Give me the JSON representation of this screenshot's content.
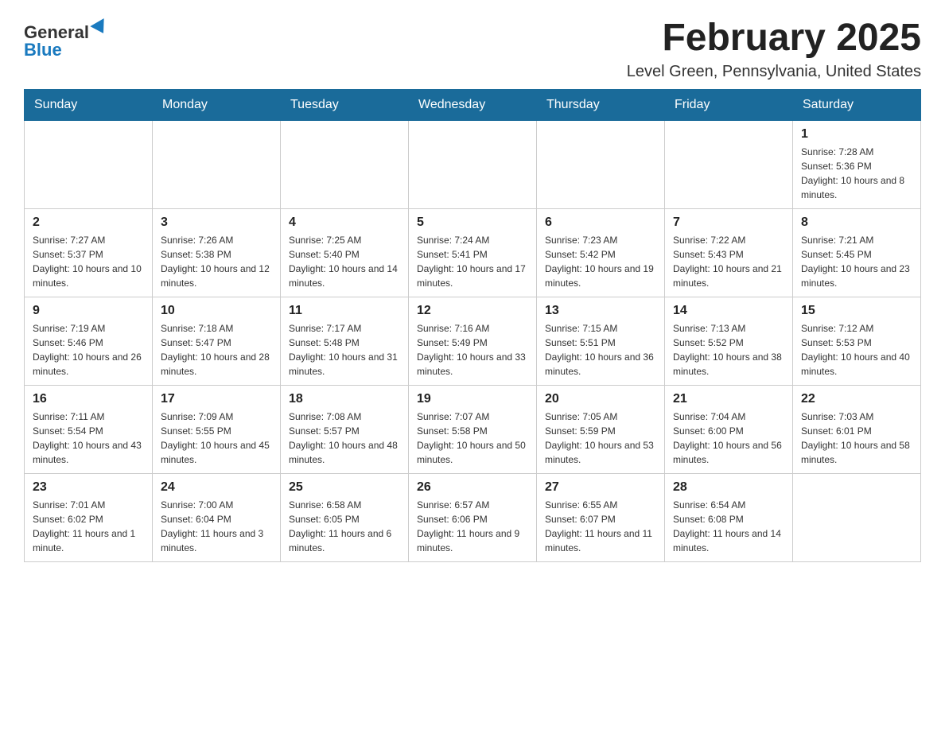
{
  "header": {
    "logo_general": "General",
    "logo_blue": "Blue",
    "month_title": "February 2025",
    "location": "Level Green, Pennsylvania, United States"
  },
  "days_of_week": [
    "Sunday",
    "Monday",
    "Tuesday",
    "Wednesday",
    "Thursday",
    "Friday",
    "Saturday"
  ],
  "weeks": [
    [
      {
        "day": "",
        "info": ""
      },
      {
        "day": "",
        "info": ""
      },
      {
        "day": "",
        "info": ""
      },
      {
        "day": "",
        "info": ""
      },
      {
        "day": "",
        "info": ""
      },
      {
        "day": "",
        "info": ""
      },
      {
        "day": "1",
        "info": "Sunrise: 7:28 AM\nSunset: 5:36 PM\nDaylight: 10 hours and 8 minutes."
      }
    ],
    [
      {
        "day": "2",
        "info": "Sunrise: 7:27 AM\nSunset: 5:37 PM\nDaylight: 10 hours and 10 minutes."
      },
      {
        "day": "3",
        "info": "Sunrise: 7:26 AM\nSunset: 5:38 PM\nDaylight: 10 hours and 12 minutes."
      },
      {
        "day": "4",
        "info": "Sunrise: 7:25 AM\nSunset: 5:40 PM\nDaylight: 10 hours and 14 minutes."
      },
      {
        "day": "5",
        "info": "Sunrise: 7:24 AM\nSunset: 5:41 PM\nDaylight: 10 hours and 17 minutes."
      },
      {
        "day": "6",
        "info": "Sunrise: 7:23 AM\nSunset: 5:42 PM\nDaylight: 10 hours and 19 minutes."
      },
      {
        "day": "7",
        "info": "Sunrise: 7:22 AM\nSunset: 5:43 PM\nDaylight: 10 hours and 21 minutes."
      },
      {
        "day": "8",
        "info": "Sunrise: 7:21 AM\nSunset: 5:45 PM\nDaylight: 10 hours and 23 minutes."
      }
    ],
    [
      {
        "day": "9",
        "info": "Sunrise: 7:19 AM\nSunset: 5:46 PM\nDaylight: 10 hours and 26 minutes."
      },
      {
        "day": "10",
        "info": "Sunrise: 7:18 AM\nSunset: 5:47 PM\nDaylight: 10 hours and 28 minutes."
      },
      {
        "day": "11",
        "info": "Sunrise: 7:17 AM\nSunset: 5:48 PM\nDaylight: 10 hours and 31 minutes."
      },
      {
        "day": "12",
        "info": "Sunrise: 7:16 AM\nSunset: 5:49 PM\nDaylight: 10 hours and 33 minutes."
      },
      {
        "day": "13",
        "info": "Sunrise: 7:15 AM\nSunset: 5:51 PM\nDaylight: 10 hours and 36 minutes."
      },
      {
        "day": "14",
        "info": "Sunrise: 7:13 AM\nSunset: 5:52 PM\nDaylight: 10 hours and 38 minutes."
      },
      {
        "day": "15",
        "info": "Sunrise: 7:12 AM\nSunset: 5:53 PM\nDaylight: 10 hours and 40 minutes."
      }
    ],
    [
      {
        "day": "16",
        "info": "Sunrise: 7:11 AM\nSunset: 5:54 PM\nDaylight: 10 hours and 43 minutes."
      },
      {
        "day": "17",
        "info": "Sunrise: 7:09 AM\nSunset: 5:55 PM\nDaylight: 10 hours and 45 minutes."
      },
      {
        "day": "18",
        "info": "Sunrise: 7:08 AM\nSunset: 5:57 PM\nDaylight: 10 hours and 48 minutes."
      },
      {
        "day": "19",
        "info": "Sunrise: 7:07 AM\nSunset: 5:58 PM\nDaylight: 10 hours and 50 minutes."
      },
      {
        "day": "20",
        "info": "Sunrise: 7:05 AM\nSunset: 5:59 PM\nDaylight: 10 hours and 53 minutes."
      },
      {
        "day": "21",
        "info": "Sunrise: 7:04 AM\nSunset: 6:00 PM\nDaylight: 10 hours and 56 minutes."
      },
      {
        "day": "22",
        "info": "Sunrise: 7:03 AM\nSunset: 6:01 PM\nDaylight: 10 hours and 58 minutes."
      }
    ],
    [
      {
        "day": "23",
        "info": "Sunrise: 7:01 AM\nSunset: 6:02 PM\nDaylight: 11 hours and 1 minute."
      },
      {
        "day": "24",
        "info": "Sunrise: 7:00 AM\nSunset: 6:04 PM\nDaylight: 11 hours and 3 minutes."
      },
      {
        "day": "25",
        "info": "Sunrise: 6:58 AM\nSunset: 6:05 PM\nDaylight: 11 hours and 6 minutes."
      },
      {
        "day": "26",
        "info": "Sunrise: 6:57 AM\nSunset: 6:06 PM\nDaylight: 11 hours and 9 minutes."
      },
      {
        "day": "27",
        "info": "Sunrise: 6:55 AM\nSunset: 6:07 PM\nDaylight: 11 hours and 11 minutes."
      },
      {
        "day": "28",
        "info": "Sunrise: 6:54 AM\nSunset: 6:08 PM\nDaylight: 11 hours and 14 minutes."
      },
      {
        "day": "",
        "info": ""
      }
    ]
  ]
}
